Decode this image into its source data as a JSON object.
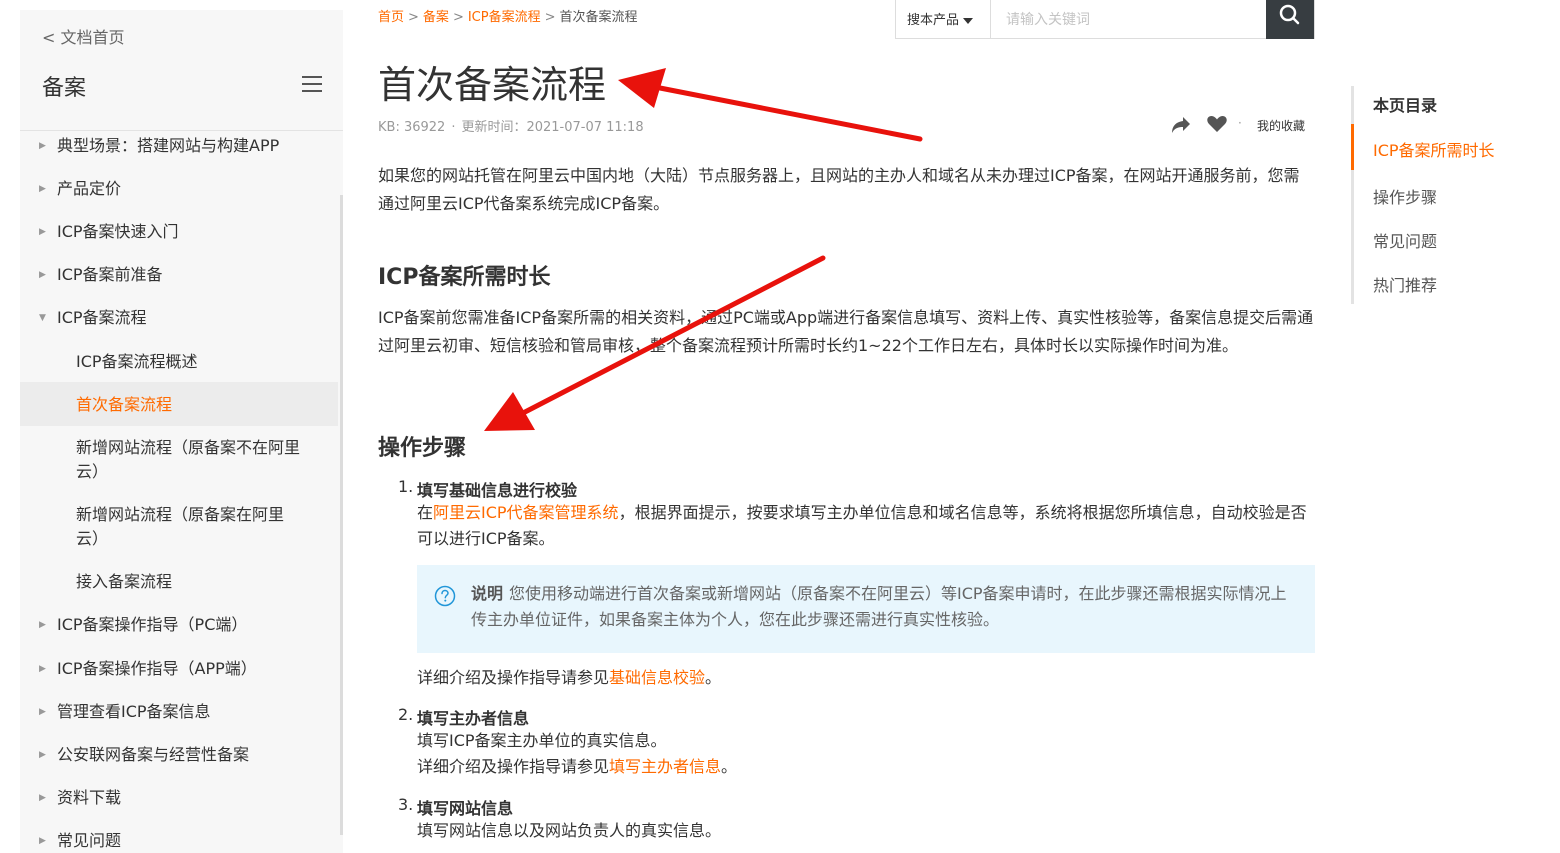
{
  "sidebar": {
    "back_label": "< 文档首页",
    "title": "备案",
    "items": [
      {
        "label": "典型场景：搭建网站与构建APP"
      },
      {
        "label": "产品定价"
      },
      {
        "label": "ICP备案快速入门"
      },
      {
        "label": "ICP备案前准备"
      },
      {
        "label": "ICP备案流程"
      },
      {
        "label": "ICP备案操作指导（PC端）"
      },
      {
        "label": "ICP备案操作指导（APP端）"
      },
      {
        "label": "管理查看ICP备案信息"
      },
      {
        "label": "公安联网备案与经营性备案"
      },
      {
        "label": "资料下载"
      },
      {
        "label": "常见问题"
      }
    ],
    "subitems": [
      {
        "label": "ICP备案流程概述"
      },
      {
        "label": "首次备案流程",
        "active": true
      },
      {
        "label": "新增网站流程（原备案不在阿里云）"
      },
      {
        "label": "新增网站流程（原备案在阿里云）"
      },
      {
        "label": "接入备案流程"
      }
    ]
  },
  "breadcrumb": {
    "items": [
      "首页",
      "备案",
      "ICP备案流程"
    ],
    "current": "首次备案流程"
  },
  "search": {
    "selector_label": "搜本产品",
    "placeholder": "请输入关键词"
  },
  "article": {
    "title": "首次备案流程",
    "kb": "KB: 36922",
    "updated": "更新时间：2021-07-07 11:18",
    "favorite_label": "我的收藏",
    "intro": "如果您的网站托管在阿里云中国内地（大陆）节点服务器上，且网站的主办人和域名从未办理过ICP备案，在网站开通服务前，您需通过阿里云ICP代备案系统完成ICP备案。",
    "section1_title": "ICP备案所需时长",
    "section1_body": "ICP备案前您需准备ICP备案所需的相关资料，通过PC端或App端进行备案信息填写、资料上传、真实性核验等，备案信息提交后需通过阿里云初审、短信核验和管局审核，整个备案流程预计所需时长约1~22个工作日左右，具体时长以实际操作时间为准。",
    "section2_title": "操作步骤",
    "steps": [
      {
        "num": "1.",
        "title": "填写基础信息进行校验",
        "pre": "在",
        "link": "阿里云ICP代备案管理系统",
        "post": "，根据界面提示，按要求填写主办单位信息和域名信息等，系统将根据您所填信息，自动校验是否可以进行ICP备案。",
        "note_label": "说明",
        "note_text": "您使用移动端进行首次备案或新增网站（原备案不在阿里云）等ICP备案申请时，在此步骤还需根据实际情况上传主办单位证件，如果备案主体为个人，您在此步骤还需进行真实性核验。",
        "detail_pre": "详细介绍及操作指导请参见",
        "detail_link": "基础信息校验",
        "detail_post": "。"
      },
      {
        "num": "2.",
        "title": "填写主办者信息",
        "body": "填写ICP备案主办单位的真实信息。",
        "detail_pre": "详细介绍及操作指导请参见",
        "detail_link": "填写主办者信息",
        "detail_post": "。"
      },
      {
        "num": "3.",
        "title": "填写网站信息",
        "body": "填写网站信息以及网站负责人的真实信息。"
      }
    ]
  },
  "toc": {
    "title": "本页目录",
    "items": [
      {
        "label": "ICP备案所需时长",
        "active": true
      },
      {
        "label": "操作步骤"
      },
      {
        "label": "常见问题"
      },
      {
        "label": "热门推荐"
      }
    ]
  },
  "colors": {
    "accent": "#ff6a00",
    "annotation_arrow": "#e8120c",
    "note_bg": "#e8f6fd",
    "search_button": "#373d41"
  }
}
